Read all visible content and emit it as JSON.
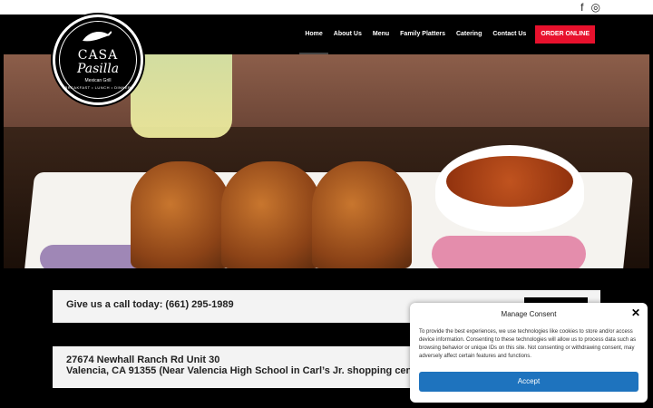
{
  "social": {
    "facebook": "f",
    "instagram": "◎"
  },
  "logo": {
    "line1": "CASA",
    "line2": "Pasilla",
    "line3": "Mexican Grill",
    "line4": "BREAKFAST • LUNCH • DINNER"
  },
  "nav": {
    "items": [
      {
        "label": "Home"
      },
      {
        "label": "About Us"
      },
      {
        "label": "Menu"
      },
      {
        "label": "Family Platters"
      },
      {
        "label": "Catering"
      },
      {
        "label": "Contact Us"
      }
    ],
    "cta": "ORDER ONLINE"
  },
  "info": {
    "phone_line": "Give us a call today: (661) 295-1989",
    "address1": "27674 Newhall Ranch Rd Unit 30",
    "address2": "Valencia, CA 91355 (Near Valencia High School in Carl’s Jr. shopping center)"
  },
  "consent": {
    "title": "Manage Consent",
    "body": "To provide the best experiences, we use technologies like cookies to store and/or access device information. Consenting to these technologies will allow us to process data such as browsing behavior or unique IDs on this site. Not consenting or withdrawing consent, may adversely affect certain features and functions.",
    "accept": "Accept",
    "close": "✕"
  },
  "colors": {
    "accent": "#e8112d",
    "accept": "#1e73be"
  }
}
